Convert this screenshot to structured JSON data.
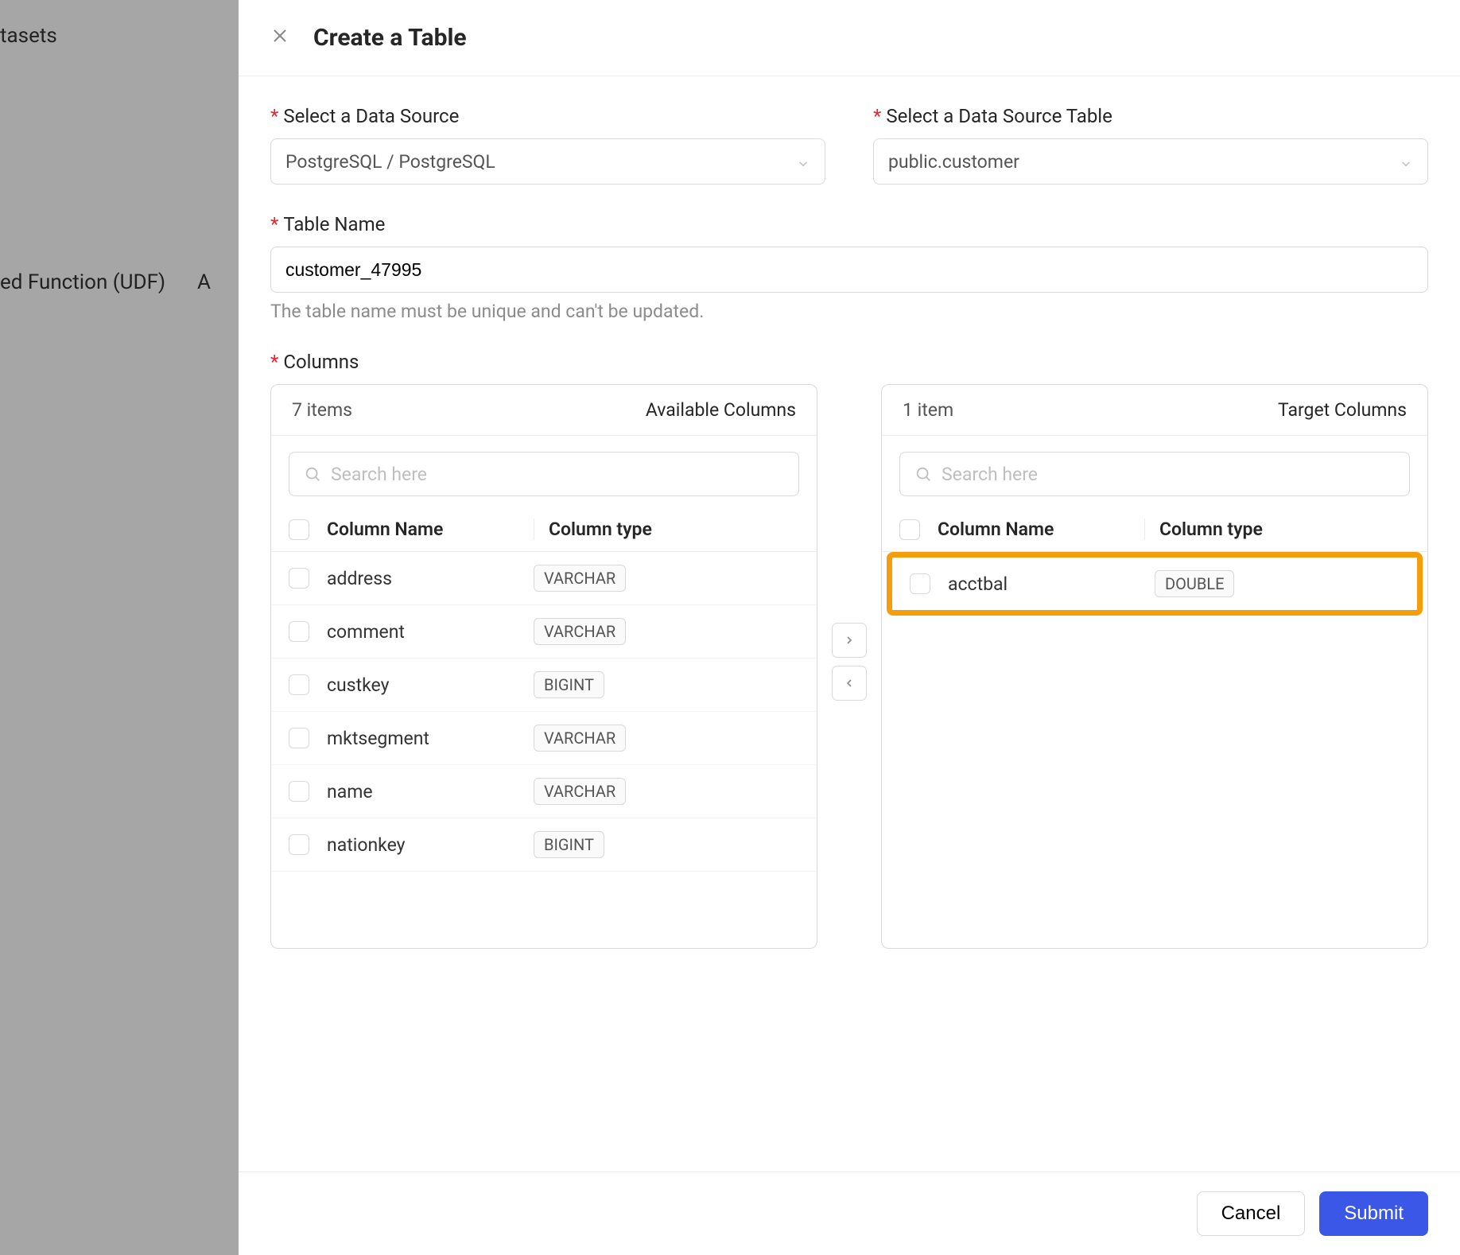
{
  "background": {
    "item1": "tasets",
    "item2": "ed Function (UDF)",
    "item3": "A"
  },
  "modal": {
    "title": "Create a Table",
    "close_aria": "Close",
    "fields": {
      "dataSource": {
        "label": "Select a Data Source",
        "value": "PostgreSQL / PostgreSQL"
      },
      "dataSourceTable": {
        "label": "Select a Data Source Table",
        "value": "public.customer"
      },
      "tableName": {
        "label": "Table Name",
        "value": "customer_47995",
        "helper": "The table name must be unique and can't be updated."
      },
      "columnsLabel": "Columns"
    },
    "available": {
      "count": "7 items",
      "title": "Available Columns",
      "searchPlaceholder": "Search here",
      "headers": {
        "name": "Column Name",
        "type": "Column type"
      },
      "rows": [
        {
          "name": "address",
          "type": "VARCHAR"
        },
        {
          "name": "comment",
          "type": "VARCHAR"
        },
        {
          "name": "custkey",
          "type": "BIGINT"
        },
        {
          "name": "mktsegment",
          "type": "VARCHAR"
        },
        {
          "name": "name",
          "type": "VARCHAR"
        },
        {
          "name": "nationkey",
          "type": "BIGINT"
        }
      ]
    },
    "target": {
      "count": "1 item",
      "title": "Target Columns",
      "searchPlaceholder": "Search here",
      "headers": {
        "name": "Column Name",
        "type": "Column type"
      },
      "rows": [
        {
          "name": "acctbal",
          "type": "DOUBLE"
        }
      ]
    },
    "footer": {
      "cancel": "Cancel",
      "submit": "Submit"
    }
  }
}
